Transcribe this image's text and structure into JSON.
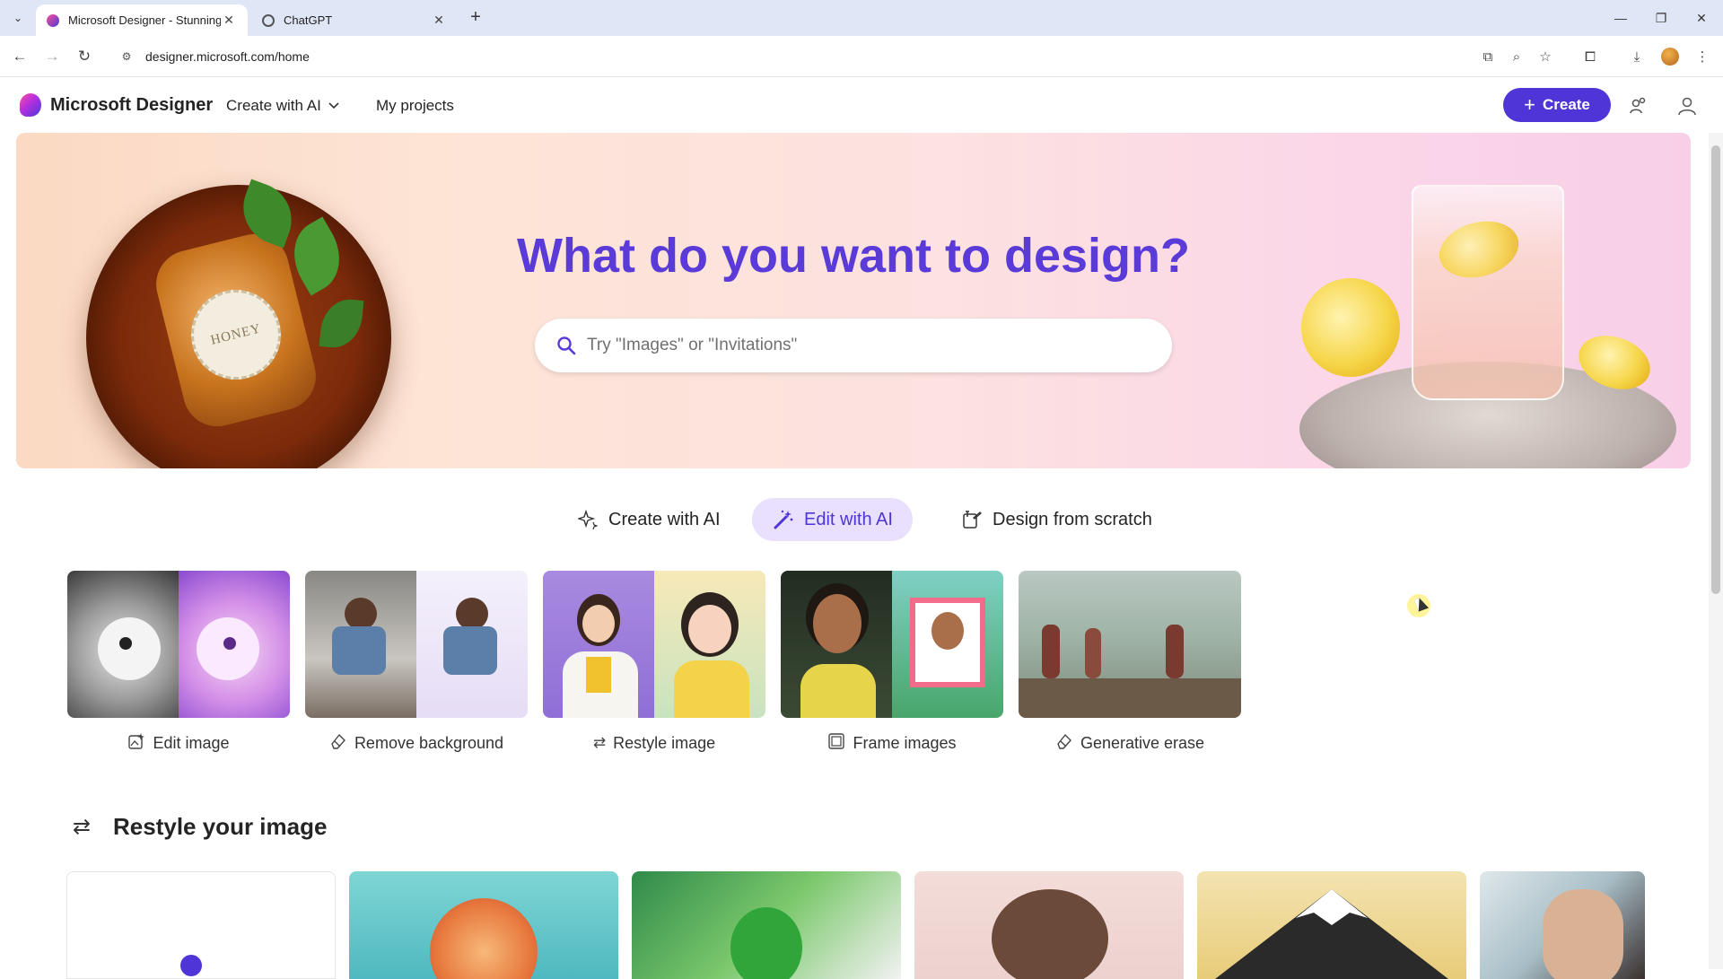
{
  "browser": {
    "tabs": [
      {
        "title": "Microsoft Designer - Stunning",
        "active": true,
        "favicon": "designer-icon"
      },
      {
        "title": "ChatGPT",
        "active": false,
        "favicon": "chatgpt-icon"
      }
    ],
    "url": "designer.microsoft.com/home"
  },
  "header": {
    "brand": "Microsoft Designer",
    "nav": {
      "create_with_ai": "Create with AI",
      "my_projects": "My projects"
    },
    "create_button": "Create"
  },
  "hero": {
    "title": "What do you want to design?",
    "search_placeholder": "Try \"Images\" or \"Invitations\"",
    "jar_label": "HONEY"
  },
  "mode_tabs": [
    {
      "label": "Create with AI",
      "icon": "sparkle-icon",
      "active": false
    },
    {
      "label": "Edit with AI",
      "icon": "magic-wand-icon",
      "active": true
    },
    {
      "label": "Design from scratch",
      "icon": "design-tools-icon",
      "active": false
    }
  ],
  "edit_cards": [
    {
      "label": "Edit image",
      "icon": "image-edit-icon"
    },
    {
      "label": "Remove background",
      "icon": "eraser-icon"
    },
    {
      "label": "Restyle image",
      "icon": "swap-icon"
    },
    {
      "label": "Frame images",
      "icon": "frame-icon"
    },
    {
      "label": "Generative erase",
      "icon": "eraser-icon"
    }
  ],
  "restyle_section": {
    "title": "Restyle your image",
    "icon": "swap-icon"
  },
  "colors": {
    "accent": "#4f35d8",
    "hero_title": "#5a3bd8",
    "active_tab_bg": "#e8e0fc"
  }
}
